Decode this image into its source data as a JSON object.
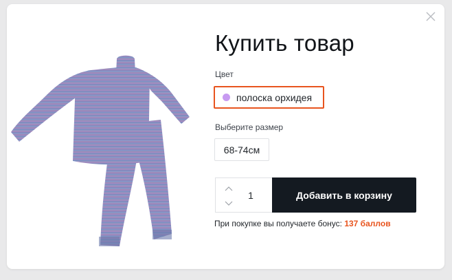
{
  "modal": {
    "title": "Купить товар",
    "product_image": {
      "description_icon": "striped-pajama-set-image"
    },
    "color": {
      "label": "Цвет",
      "selected": {
        "name": "полоска орхидея",
        "swatch_color": "#c79af1"
      }
    },
    "size": {
      "label": "Выберите размер",
      "selected": "68-74см"
    },
    "quantity": {
      "value": "1"
    },
    "add_to_cart_label": "Добавить в корзину",
    "bonus": {
      "text": "При покупке вы получаете бонус:",
      "points": "137 баллов"
    }
  },
  "colors": {
    "accent": "#e8541e",
    "button_dark": "#141a21"
  }
}
